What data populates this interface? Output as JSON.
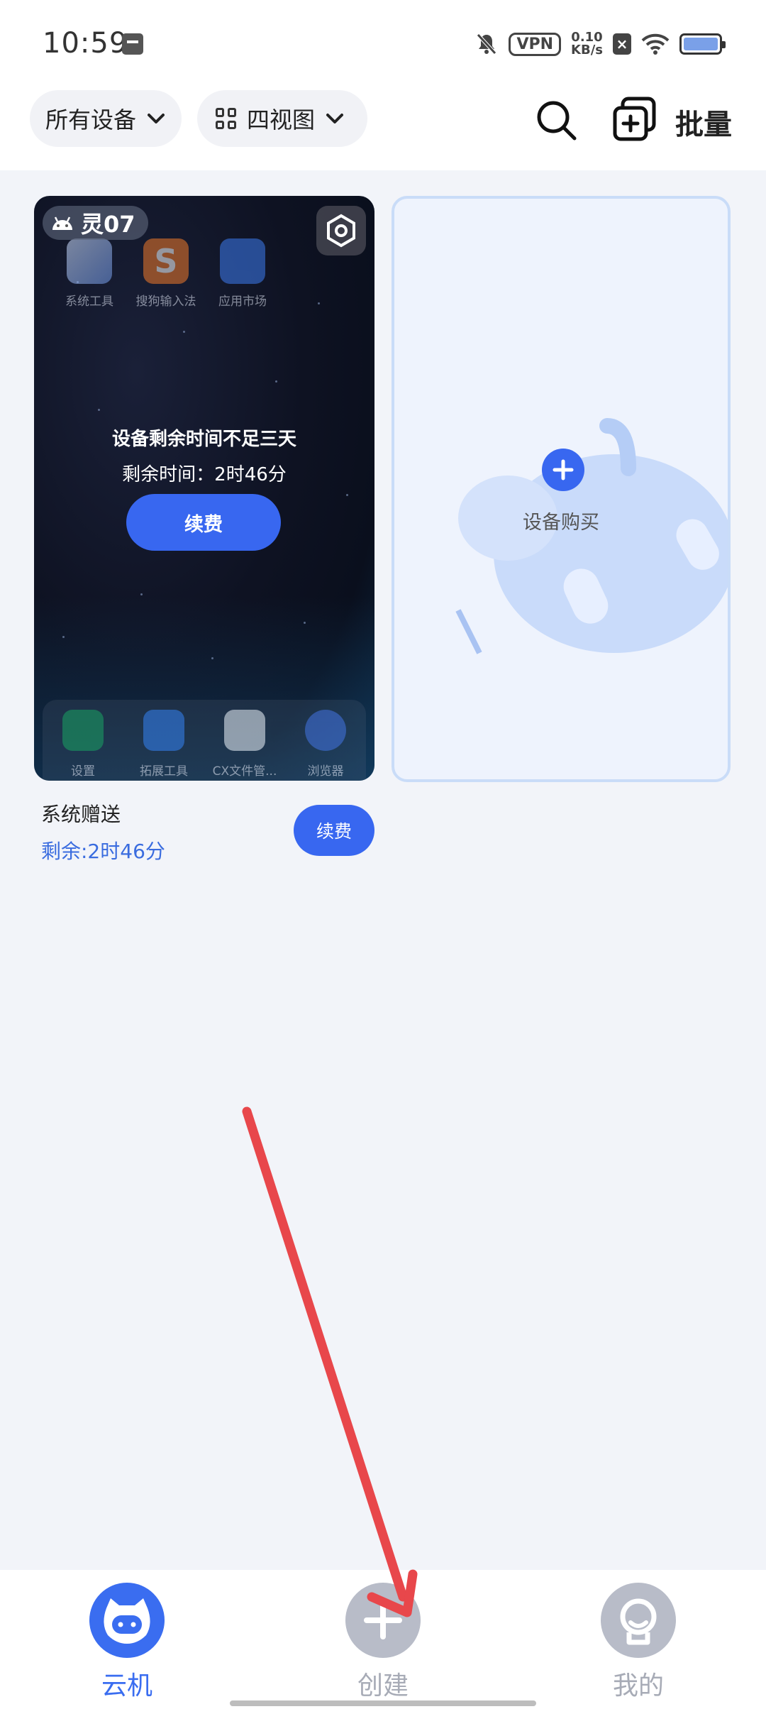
{
  "status_bar": {
    "time": "10:59",
    "vpn": "VPN",
    "speed_value": "0.10",
    "speed_unit": "KB/s",
    "icons": [
      "calendar-icon",
      "bell-off-icon",
      "vpn-icon",
      "no-sim-icon",
      "wifi-icon",
      "battery-icon"
    ]
  },
  "toolbar": {
    "device_filter": "所有设备",
    "view_mode": "四视图",
    "batch_label": "批量"
  },
  "device_card": {
    "badge": "灵07",
    "apps_top": [
      "系统工具",
      "搜狗输入法",
      "应用市场"
    ],
    "apps_dock": [
      "设置",
      "拓展工具",
      "CX文件管...",
      "浏览器"
    ],
    "expire_title": "设备剩余时间不足三天",
    "expire_time": "剩余时间：2时46分",
    "renew_label": "续费",
    "name": "系统赠送",
    "remaining": "剩余:2时46分",
    "renew_small_label": "续费"
  },
  "buy_card": {
    "label": "设备购买"
  },
  "bottom_nav": {
    "items": [
      {
        "label": "云机",
        "active": true
      },
      {
        "label": "创建",
        "active": false
      },
      {
        "label": "我的",
        "active": false
      }
    ]
  },
  "colors": {
    "accent": "#3867f0",
    "remaining_text": "#3a6cdf",
    "annotation_arrow": "#e8474b",
    "nav_inactive": "#b8bcc8"
  }
}
